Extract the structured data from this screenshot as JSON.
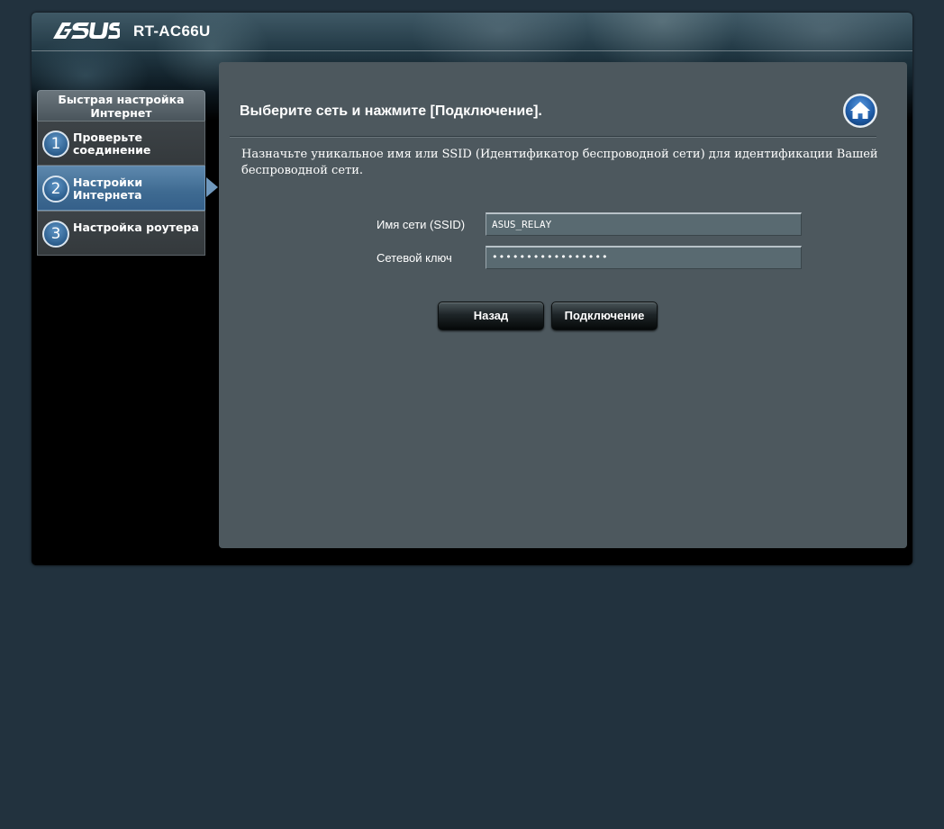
{
  "header": {
    "brand": "ASUS",
    "model": "RT-AC66U"
  },
  "sidebar": {
    "title": "Быстрая настройка Интернет",
    "steps": [
      {
        "number": "1",
        "label": "Проверьте соединение",
        "active": false
      },
      {
        "number": "2",
        "label": "Настройки Интернета",
        "active": true
      },
      {
        "number": "3",
        "label": "Настройка роутера",
        "active": false
      }
    ]
  },
  "main": {
    "title": "Выберите сеть и нажмите [Подключение].",
    "description": "Назначьте уникальное имя или SSID (Идентификатор беспроводной сети) для идентификации Вашей беспроводной сети.",
    "home_icon": "home-icon",
    "fields": {
      "ssid_label": "Имя сети (SSID)",
      "ssid_value": "ASUS_RELAY",
      "key_label": "Сетевой ключ",
      "key_value": "•••••••••••••••••"
    },
    "buttons": {
      "back": "Назад",
      "connect": "Подключение"
    }
  },
  "colors": {
    "page_bg": "#22323e",
    "panel_bg": "#4d585e",
    "active_step": "#3e6a91"
  }
}
